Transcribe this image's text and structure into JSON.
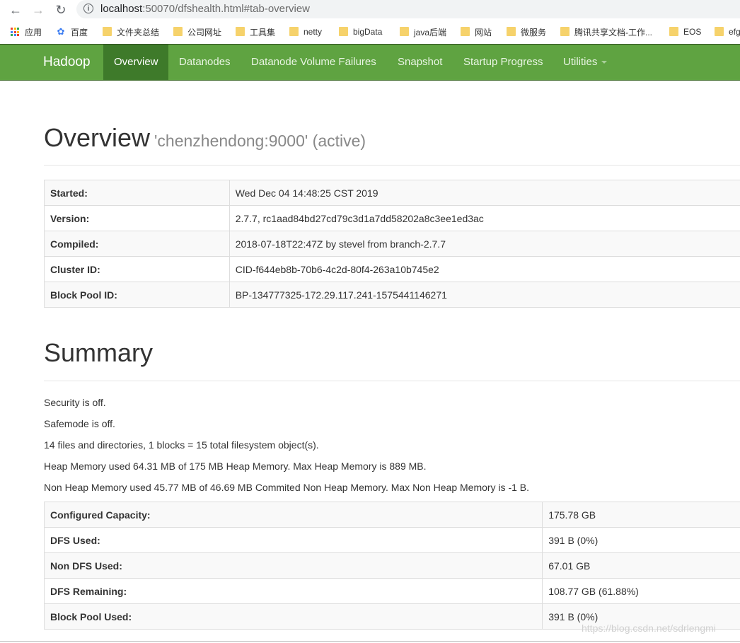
{
  "browser": {
    "url_host": "localhost",
    "url_rest": ":50070/dfshealth.html#tab-overview",
    "bookmarks": [
      {
        "label": "应用",
        "icon": "apps-grid-icon"
      },
      {
        "label": "百度",
        "icon": "baidu-paw-icon"
      },
      {
        "label": "文件夹总结",
        "icon": "folder-icon"
      },
      {
        "label": "公司网址",
        "icon": "folder-icon"
      },
      {
        "label": "工具集",
        "icon": "folder-icon"
      },
      {
        "label": "netty",
        "icon": "folder-icon"
      },
      {
        "label": "bigData",
        "icon": "folder-icon"
      },
      {
        "label": "java后端",
        "icon": "folder-icon"
      },
      {
        "label": "网站",
        "icon": "folder-icon"
      },
      {
        "label": "微服务",
        "icon": "folder-icon"
      },
      {
        "label": "腾讯共享文档-工作...",
        "icon": "folder-icon"
      },
      {
        "label": "EOS",
        "icon": "folder-icon"
      },
      {
        "label": "efg",
        "icon": "folder-icon"
      }
    ]
  },
  "navbar": {
    "brand": "Hadoop",
    "items": [
      "Overview",
      "Datanodes",
      "Datanode Volume Failures",
      "Snapshot",
      "Startup Progress",
      "Utilities"
    ],
    "active": "Overview",
    "color": "#5fa341"
  },
  "overview": {
    "title": "Overview",
    "subtitle": "'chenzhendong:9000' (active)",
    "rows": [
      {
        "key": "Started:",
        "value": "Wed Dec 04 14:48:25 CST 2019"
      },
      {
        "key": "Version:",
        "value": "2.7.7, rc1aad84bd27cd79c3d1a7dd58202a8c3ee1ed3ac"
      },
      {
        "key": "Compiled:",
        "value": "2018-07-18T22:47Z by stevel from branch-2.7.7"
      },
      {
        "key": "Cluster ID:",
        "value": "CID-f644eb8b-70b6-4c2d-80f4-263a10b745e2"
      },
      {
        "key": "Block Pool ID:",
        "value": "BP-134777325-172.29.117.241-1575441146271"
      }
    ]
  },
  "summary": {
    "title": "Summary",
    "lines": [
      "Security is off.",
      "Safemode is off.",
      "14 files and directories, 1 blocks = 15 total filesystem object(s).",
      "Heap Memory used 64.31 MB of 175 MB Heap Memory. Max Heap Memory is 889 MB.",
      "Non Heap Memory used 45.77 MB of 46.69 MB Commited Non Heap Memory. Max Non Heap Memory is -1 B."
    ],
    "rows": [
      {
        "key": "Configured Capacity:",
        "value": "175.78 GB"
      },
      {
        "key": "DFS Used:",
        "value": "391 B (0%)"
      },
      {
        "key": "Non DFS Used:",
        "value": "67.01 GB"
      },
      {
        "key": "DFS Remaining:",
        "value": "108.77 GB (61.88%)"
      },
      {
        "key": "Block Pool Used:",
        "value": "391 B (0%)"
      }
    ]
  },
  "watermark": "https://blog.csdn.net/sdrlengmi"
}
